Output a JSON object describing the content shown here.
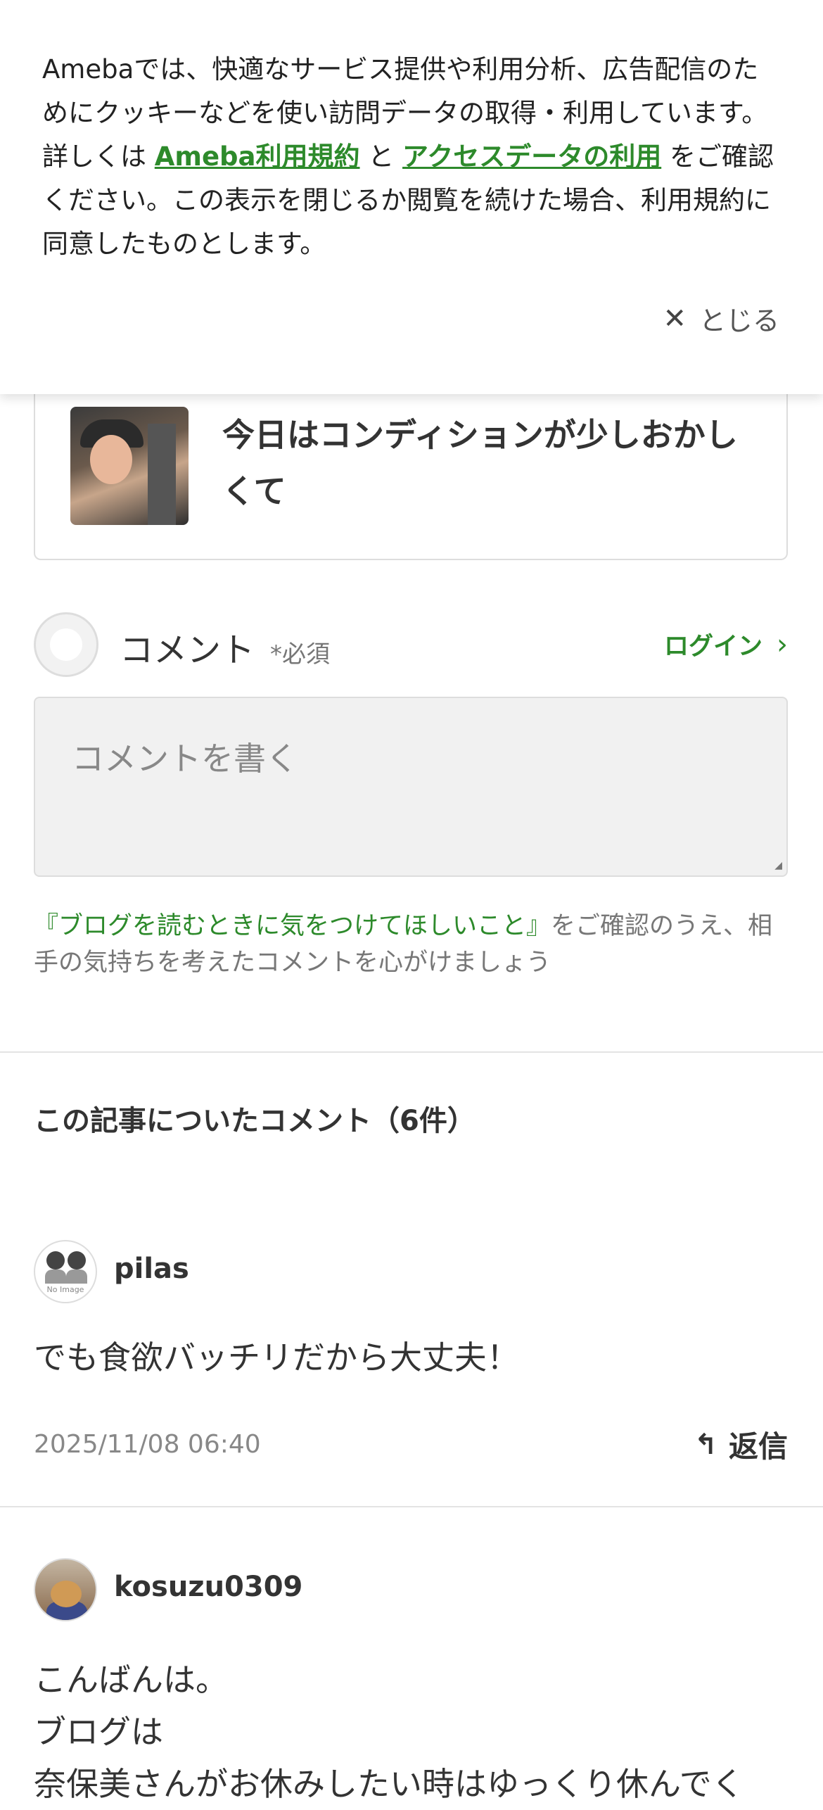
{
  "cookie_banner": {
    "text_before": "Amebaでは、快適なサービス提供や利用分析、広告配信のためにクッキーなどを使い訪問データの取得・利用しています。詳しくは ",
    "link_terms": "Ameba利用規約",
    "text_between": " と ",
    "link_access": "アクセスデータの利用",
    "text_after": " をご確認ください。この表示を閉じるか閲覧を続けた場合、利用規約に同意したものとします。",
    "close_label": "とじる"
  },
  "article": {
    "title": "今日はコンディションが少しおかしくて"
  },
  "comment_form": {
    "label": "コメント",
    "required": "*必須",
    "login": "ログイン",
    "placeholder": "コメントを書く",
    "guideline_link": "『ブログを読むときに気をつけてほしいこと』",
    "guideline_text": "をご確認のうえ、相手の気持ちを考えたコメントを心がけましょう"
  },
  "comments_section": {
    "title": "この記事についたコメント（6件）",
    "items": [
      {
        "name": "pilas",
        "text": "でも食欲バッチリだから大丈夫！",
        "date": "2025/11/08 06:40",
        "reply": "返信",
        "avatar_label": "No Image"
      },
      {
        "name": "kosuzu0309",
        "text": "こんばんは。\nブログは\n奈保美さんがお休みしたい時はゆっくり休んでく"
      }
    ]
  },
  "icons": {
    "close": "close-icon",
    "chevron": "chevron-right-icon",
    "reply": "reply-icon"
  },
  "colors": {
    "accent": "#2d8a2b",
    "text": "#333333",
    "muted": "#888888"
  }
}
